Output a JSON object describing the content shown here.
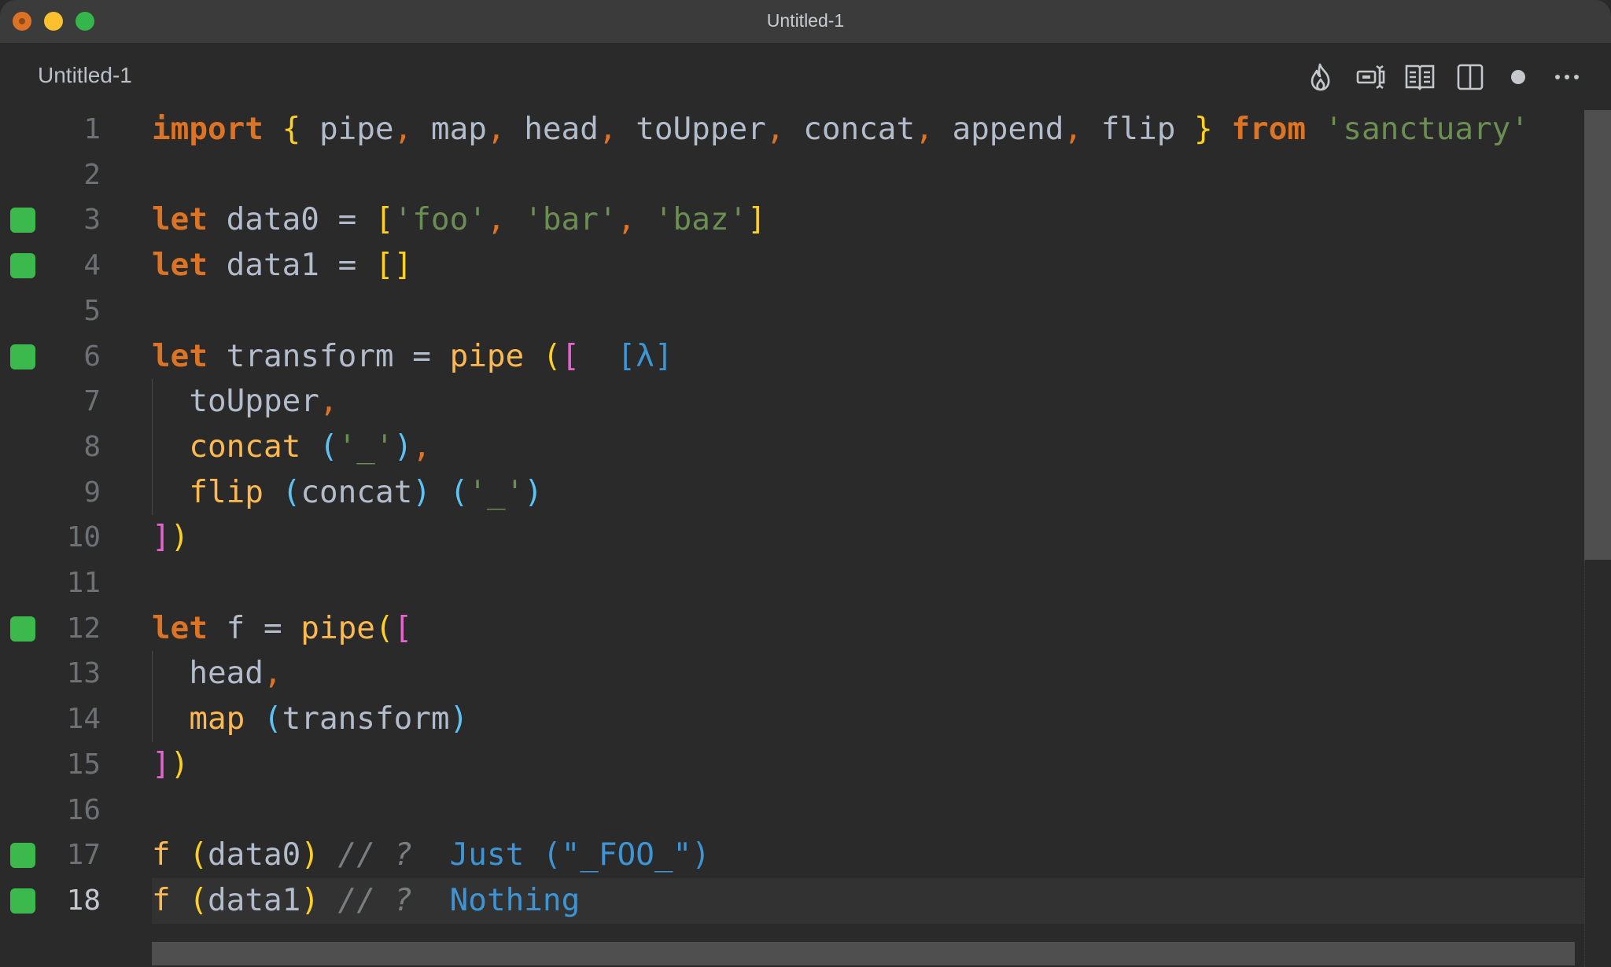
{
  "window": {
    "title": "Untitled-1",
    "traffic_lights": [
      "close",
      "minimize",
      "maximize"
    ]
  },
  "tab": {
    "label": "Untitled-1",
    "dirty": true
  },
  "toolbar": {
    "actions": [
      {
        "name": "flame-icon",
        "label": "Quokka"
      },
      {
        "name": "inline-value-icon",
        "label": "Toggle inline values"
      },
      {
        "name": "open-preview-icon",
        "label": "Open preview"
      },
      {
        "name": "split-editor-icon",
        "label": "Split editor"
      },
      {
        "name": "unsaved-dot-icon",
        "label": "Unsaved changes"
      },
      {
        "name": "more-actions-icon",
        "label": "More actions"
      }
    ]
  },
  "editor": {
    "current_line": 18,
    "lines": [
      {
        "n": "1",
        "marker": false,
        "tokens": [
          [
            "kw",
            "import"
          ],
          [
            "id",
            " "
          ],
          [
            "br1",
            "{"
          ],
          [
            "id",
            " pipe"
          ],
          [
            "punc",
            ","
          ],
          [
            "id",
            " map"
          ],
          [
            "punc",
            ","
          ],
          [
            "id",
            " head"
          ],
          [
            "punc",
            ","
          ],
          [
            "id",
            " toUpper"
          ],
          [
            "punc",
            ","
          ],
          [
            "id",
            " concat"
          ],
          [
            "punc",
            ","
          ],
          [
            "id",
            " append"
          ],
          [
            "punc",
            ","
          ],
          [
            "id",
            " flip "
          ],
          [
            "br1",
            "}"
          ],
          [
            "id",
            " "
          ],
          [
            "kw",
            "from"
          ],
          [
            "id",
            " "
          ],
          [
            "str",
            "'sanctuary'"
          ]
        ]
      },
      {
        "n": "2",
        "marker": false,
        "tokens": []
      },
      {
        "n": "3",
        "marker": true,
        "tokens": [
          [
            "kw",
            "let"
          ],
          [
            "id",
            " data0 = "
          ],
          [
            "br1",
            "["
          ],
          [
            "str",
            "'foo'"
          ],
          [
            "punc",
            ","
          ],
          [
            "id",
            " "
          ],
          [
            "str",
            "'bar'"
          ],
          [
            "punc",
            ","
          ],
          [
            "id",
            " "
          ],
          [
            "str",
            "'baz'"
          ],
          [
            "br1",
            "]"
          ]
        ]
      },
      {
        "n": "4",
        "marker": true,
        "tokens": [
          [
            "kw",
            "let"
          ],
          [
            "id",
            " data1 = "
          ],
          [
            "br1",
            "[]"
          ]
        ]
      },
      {
        "n": "5",
        "marker": false,
        "tokens": []
      },
      {
        "n": "6",
        "marker": true,
        "tokens": [
          [
            "kw",
            "let"
          ],
          [
            "id",
            " transform = "
          ],
          [
            "fn",
            "pipe"
          ],
          [
            "id",
            " "
          ],
          [
            "br1",
            "("
          ],
          [
            "br2",
            "["
          ],
          [
            "id",
            "  "
          ],
          [
            "lam",
            "[λ]"
          ]
        ]
      },
      {
        "n": "7",
        "marker": false,
        "tokens": [
          [
            "id",
            "  toUpper"
          ],
          [
            "punc",
            ","
          ]
        ]
      },
      {
        "n": "8",
        "marker": false,
        "tokens": [
          [
            "id",
            "  "
          ],
          [
            "fn",
            "concat"
          ],
          [
            "id",
            " "
          ],
          [
            "br3",
            "("
          ],
          [
            "str",
            "'_'"
          ],
          [
            "br3",
            ")"
          ],
          [
            "punc",
            ","
          ]
        ]
      },
      {
        "n": "9",
        "marker": false,
        "tokens": [
          [
            "id",
            "  "
          ],
          [
            "fn",
            "flip"
          ],
          [
            "id",
            " "
          ],
          [
            "br3",
            "("
          ],
          [
            "id",
            "concat"
          ],
          [
            "br3",
            ")"
          ],
          [
            "id",
            " "
          ],
          [
            "br3",
            "("
          ],
          [
            "str",
            "'_'"
          ],
          [
            "br3",
            ")"
          ]
        ]
      },
      {
        "n": "10",
        "marker": false,
        "tokens": [
          [
            "br2",
            "]"
          ],
          [
            "br1",
            ")"
          ]
        ]
      },
      {
        "n": "11",
        "marker": false,
        "tokens": []
      },
      {
        "n": "12",
        "marker": true,
        "tokens": [
          [
            "kw",
            "let"
          ],
          [
            "id",
            " f = "
          ],
          [
            "fn",
            "pipe"
          ],
          [
            "br1",
            "("
          ],
          [
            "br2",
            "["
          ]
        ]
      },
      {
        "n": "13",
        "marker": false,
        "tokens": [
          [
            "id",
            "  head"
          ],
          [
            "punc",
            ","
          ]
        ]
      },
      {
        "n": "14",
        "marker": false,
        "tokens": [
          [
            "id",
            "  "
          ],
          [
            "fn",
            "map"
          ],
          [
            "id",
            " "
          ],
          [
            "br3",
            "("
          ],
          [
            "id",
            "transform"
          ],
          [
            "br3",
            ")"
          ]
        ]
      },
      {
        "n": "15",
        "marker": false,
        "tokens": [
          [
            "br2",
            "]"
          ],
          [
            "br1",
            ")"
          ]
        ]
      },
      {
        "n": "16",
        "marker": false,
        "tokens": []
      },
      {
        "n": "17",
        "marker": true,
        "tokens": [
          [
            "fn",
            "f"
          ],
          [
            "id",
            " "
          ],
          [
            "br1",
            "("
          ],
          [
            "id",
            "data0"
          ],
          [
            "br1",
            ")"
          ],
          [
            "id",
            " "
          ],
          [
            "cmt",
            "// ?"
          ],
          [
            "id",
            "  "
          ],
          [
            "res",
            "Just (\"_FOO_\")"
          ]
        ]
      },
      {
        "n": "18",
        "marker": true,
        "tokens": [
          [
            "fn",
            "f"
          ],
          [
            "id",
            " "
          ],
          [
            "br1",
            "("
          ],
          [
            "id",
            "data1"
          ],
          [
            "br1",
            ")"
          ],
          [
            "id",
            " "
          ],
          [
            "cmt",
            "// ?"
          ],
          [
            "id",
            "  "
          ],
          [
            "res",
            "Nothing"
          ]
        ]
      }
    ],
    "indent_guides": [
      {
        "from_line": 7,
        "to_line": 9
      },
      {
        "from_line": 13,
        "to_line": 14
      }
    ]
  },
  "colors": {
    "background": "#2a2a2a",
    "titlebar": "#3b3b3b",
    "keyword": "#dd7425",
    "function": "#fdb950",
    "identifier": "#b2bccb",
    "string": "#6b8e53",
    "bracket_level1": "#fdd022",
    "bracket_level2": "#e265cf",
    "bracket_level3": "#5cc3f4",
    "inline_result": "#3d95d6",
    "comment": "#7a7d82",
    "coverage_marker": "#3bb94c"
  }
}
